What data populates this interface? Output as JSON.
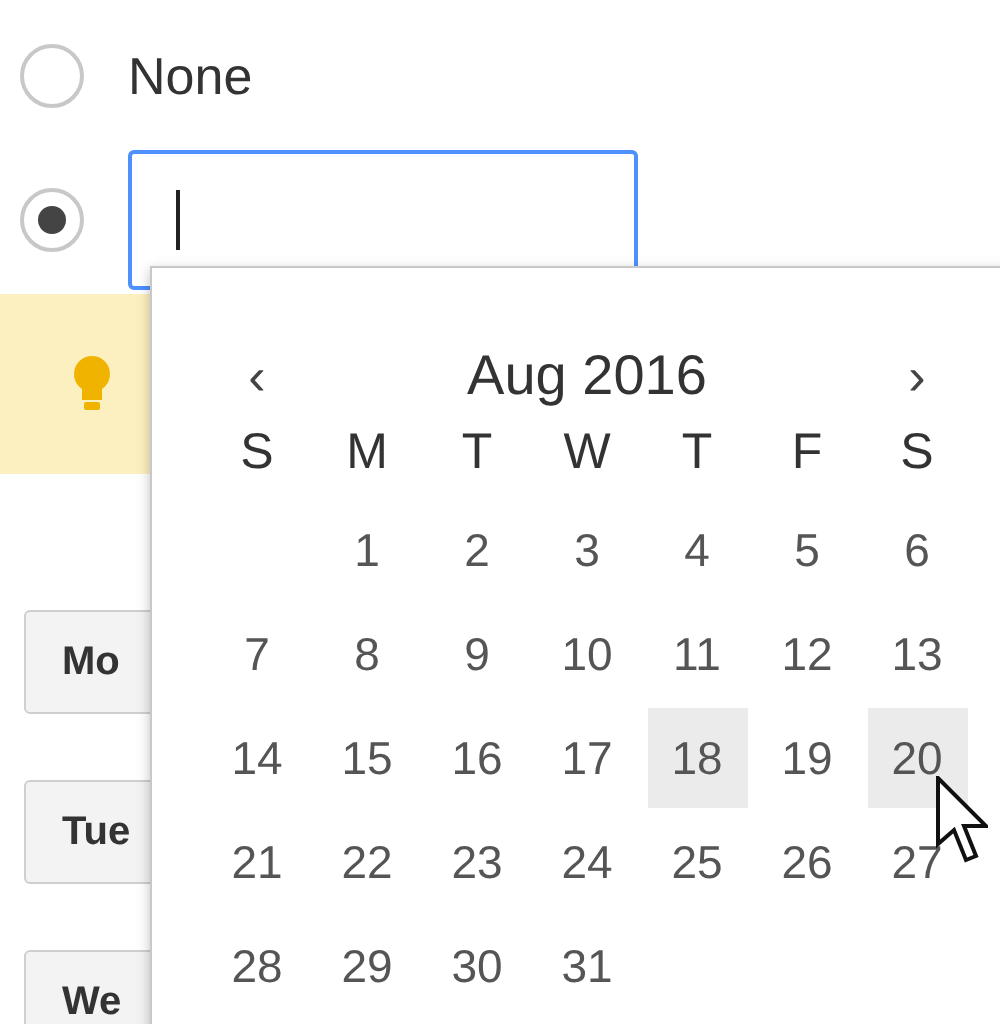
{
  "options": [
    {
      "kind": "label",
      "label": "None",
      "selected": false
    },
    {
      "kind": "field",
      "selected": true,
      "focused": true
    }
  ],
  "day_buttons": [
    "Mo",
    "Tue",
    "We"
  ],
  "calendar": {
    "prev": "‹",
    "month": "Aug 2016",
    "next": "›",
    "weekdays": [
      "S",
      "M",
      "T",
      "W",
      "T",
      "F",
      "S"
    ],
    "weeks": [
      [
        {
          "kind": "blank"
        },
        {
          "kind": "day",
          "day": "1",
          "highlighted": false
        },
        {
          "kind": "day",
          "day": "2",
          "highlighted": false
        },
        {
          "kind": "day",
          "day": "3",
          "highlighted": false
        },
        {
          "kind": "day",
          "day": "4",
          "highlighted": false
        },
        {
          "kind": "day",
          "day": "5",
          "highlighted": false
        },
        {
          "kind": "day",
          "day": "6",
          "highlighted": false
        }
      ],
      [
        {
          "kind": "day",
          "day": "7",
          "highlighted": false
        },
        {
          "kind": "day",
          "day": "8",
          "highlighted": false
        },
        {
          "kind": "day",
          "day": "9",
          "highlighted": false
        },
        {
          "kind": "day",
          "day": "10",
          "highlighted": false
        },
        {
          "kind": "day",
          "day": "11",
          "highlighted": false
        },
        {
          "kind": "day",
          "day": "12",
          "highlighted": false
        },
        {
          "kind": "day",
          "day": "13",
          "highlighted": false
        }
      ],
      [
        {
          "kind": "day",
          "day": "14",
          "highlighted": false
        },
        {
          "kind": "day",
          "day": "15",
          "highlighted": false
        },
        {
          "kind": "day",
          "day": "16",
          "highlighted": false
        },
        {
          "kind": "day",
          "day": "17",
          "highlighted": false
        },
        {
          "kind": "day",
          "day": "18",
          "highlighted": true
        },
        {
          "kind": "day",
          "day": "19",
          "highlighted": false
        },
        {
          "kind": "day",
          "day": "20",
          "highlighted": true
        }
      ],
      [
        {
          "kind": "day",
          "day": "21",
          "highlighted": false
        },
        {
          "kind": "day",
          "day": "22",
          "highlighted": false
        },
        {
          "kind": "day",
          "day": "23",
          "highlighted": false
        },
        {
          "kind": "day",
          "day": "24",
          "highlighted": false
        },
        {
          "kind": "day",
          "day": "25",
          "highlighted": false
        },
        {
          "kind": "day",
          "day": "26",
          "highlighted": false
        },
        {
          "kind": "day",
          "day": "27",
          "highlighted": false
        }
      ],
      [
        {
          "kind": "day",
          "day": "28",
          "highlighted": false
        },
        {
          "kind": "day",
          "day": "29",
          "highlighted": false
        },
        {
          "kind": "day",
          "day": "30",
          "highlighted": false
        },
        {
          "kind": "day",
          "day": "31",
          "highlighted": false
        },
        {
          "kind": "blank"
        },
        {
          "kind": "blank"
        },
        {
          "kind": "blank"
        }
      ]
    ]
  }
}
